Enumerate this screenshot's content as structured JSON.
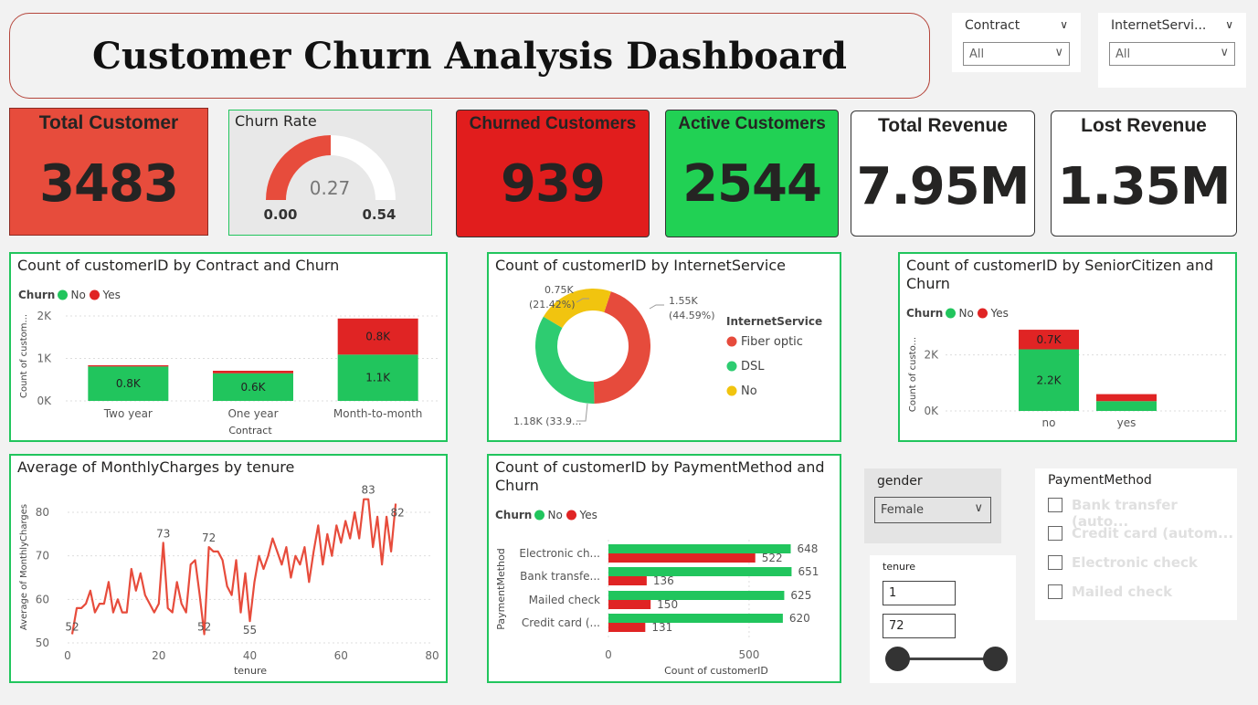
{
  "title": "Customer Churn Analysis Dashboard",
  "filters": {
    "contract": {
      "label": "Contract",
      "value": "All"
    },
    "internet": {
      "label": "InternetServi...",
      "value": "All"
    },
    "gender": {
      "label": "gender",
      "value": "Female"
    },
    "tenure": {
      "label": "tenure",
      "min": "1",
      "max": "72"
    },
    "payment": {
      "label": "PaymentMethod",
      "options": [
        "Bank transfer (auto...",
        "Credit card (autom...",
        "Electronic check",
        "Mailed check"
      ]
    }
  },
  "cards": {
    "total": {
      "label": "Total Customer",
      "value": "3483"
    },
    "churn_rate": {
      "label": "Churn Rate",
      "value": "0.27",
      "min": "0.00",
      "max": "0.54"
    },
    "churned": {
      "label": "Churned Customers",
      "value": "939"
    },
    "active": {
      "label": "Active Customers",
      "value": "2544"
    },
    "revenue": {
      "label": "Total Revenue",
      "value": "7.95M"
    },
    "lost": {
      "label": "Lost Revenue",
      "value": "1.35M"
    }
  },
  "colors": {
    "no": "#21c55d",
    "yes": "#e02424",
    "fiber": "#e64b3c",
    "dsl": "#2ecc71",
    "none": "#f1c40f"
  },
  "chart_data": [
    {
      "type": "bar",
      "title": "Count of customerID by Contract and Churn",
      "legend_title": "Churn",
      "xlabel": "Contract",
      "ylabel": "Count of custom...",
      "categories": [
        "Two year",
        "One year",
        "Month-to-month"
      ],
      "series": [
        {
          "name": "No",
          "values": [
            810,
            650,
            1090
          ],
          "labels": [
            "0.8K",
            "0.6K",
            "1.1K"
          ]
        },
        {
          "name": "Yes",
          "values": [
            30,
            60,
            850
          ],
          "labels": [
            "",
            "",
            "0.8K"
          ]
        }
      ],
      "yticks": [
        "0K",
        "1K",
        "2K"
      ],
      "ylim": [
        0,
        2000
      ]
    },
    {
      "type": "pie",
      "title": "Count of customerID by InternetService",
      "legend_title": "InternetService",
      "slices": [
        {
          "name": "Fiber optic",
          "value": 1550,
          "label": "1.55K",
          "pct": "(44.59%)"
        },
        {
          "name": "DSL",
          "value": 1180,
          "label": "1.18K (33.9...",
          "pct": ""
        },
        {
          "name": "No",
          "value": 750,
          "label": "0.75K",
          "pct": "(21.42%)"
        }
      ]
    },
    {
      "type": "bar",
      "title": "Count of customerID by SeniorCitizen and Churn",
      "legend_title": "Churn",
      "ylabel": "Count of custo...",
      "categories": [
        "no",
        "yes"
      ],
      "series": [
        {
          "name": "No",
          "values": [
            2200,
            350
          ],
          "labels": [
            "2.2K",
            ""
          ]
        },
        {
          "name": "Yes",
          "values": [
            700,
            250
          ],
          "labels": [
            "0.7K",
            ""
          ]
        }
      ],
      "yticks": [
        "0K",
        "2K"
      ],
      "ylim": [
        0,
        3000
      ]
    },
    {
      "type": "line",
      "title": "Average of MonthlyCharges by tenure",
      "xlabel": "tenure",
      "ylabel": "Average of MonthlyCharges",
      "xlim": [
        0,
        80
      ],
      "ylim": [
        50,
        80
      ],
      "xticks": [
        "0",
        "20",
        "40",
        "60",
        "80"
      ],
      "yticks": [
        "50",
        "60",
        "70",
        "80"
      ],
      "x": [
        1,
        2,
        3,
        4,
        5,
        6,
        7,
        8,
        9,
        10,
        11,
        12,
        13,
        14,
        15,
        16,
        17,
        18,
        19,
        20,
        21,
        22,
        23,
        24,
        25,
        26,
        27,
        28,
        29,
        30,
        31,
        32,
        33,
        34,
        35,
        36,
        37,
        38,
        39,
        40,
        41,
        42,
        43,
        44,
        45,
        46,
        47,
        48,
        49,
        50,
        51,
        52,
        53,
        54,
        55,
        56,
        57,
        58,
        59,
        60,
        61,
        62,
        63,
        64,
        65,
        66,
        67,
        68,
        69,
        70,
        71,
        72
      ],
      "y": [
        52,
        58,
        58,
        59,
        62,
        57,
        59,
        59,
        64,
        57,
        60,
        57,
        57,
        67,
        62,
        66,
        61,
        59,
        57,
        59,
        73,
        58,
        57,
        64,
        59,
        57,
        68,
        69,
        61,
        52,
        72,
        71,
        71,
        69,
        63,
        61,
        69,
        57,
        66,
        55,
        64,
        70,
        67,
        70,
        74,
        71,
        68,
        72,
        65,
        70,
        68,
        72,
        64,
        71,
        77,
        68,
        75,
        70,
        77,
        73,
        78,
        74,
        80,
        74,
        83,
        83,
        72,
        79,
        68,
        79,
        71,
        82
      ],
      "annotations": [
        {
          "x": 1,
          "y": 52,
          "label": "52"
        },
        {
          "x": 21,
          "y": 73,
          "label": "73"
        },
        {
          "x": 30,
          "y": 52,
          "label": "52"
        },
        {
          "x": 31,
          "y": 72,
          "label": "72"
        },
        {
          "x": 40,
          "y": 55,
          "label": "55"
        },
        {
          "x": 66,
          "y": 83,
          "label": "83"
        },
        {
          "x": 72,
          "y": 82,
          "label": "82"
        }
      ]
    },
    {
      "type": "bar",
      "orientation": "horizontal",
      "title": "Count of customerID by PaymentMethod and Churn",
      "legend_title": "Churn",
      "xlabel": "Count of customerID",
      "ylabel": "PaymentMethod",
      "categories": [
        "Electronic ch...",
        "Bank transfe...",
        "Mailed check",
        "Credit card (..."
      ],
      "series": [
        {
          "name": "No",
          "values": [
            648,
            651,
            625,
            620
          ]
        },
        {
          "name": "Yes",
          "values": [
            522,
            136,
            150,
            131
          ]
        }
      ],
      "xticks": [
        "0",
        "500"
      ],
      "xlim": [
        0,
        760
      ]
    }
  ]
}
